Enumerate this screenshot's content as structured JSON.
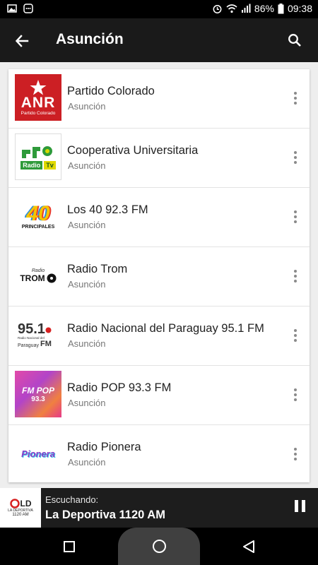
{
  "status_bar": {
    "battery": "86%",
    "time": "09:38"
  },
  "app_bar": {
    "title": "Asunción"
  },
  "stations": [
    {
      "name": "Partido Colorado",
      "city": "Asunción",
      "logo": "anr-logo"
    },
    {
      "name": "Cooperativa Universitaria",
      "city": "Asunción",
      "logo": "radio-tv-logo"
    },
    {
      "name": "Los 40 92.3 FM",
      "city": "Asunción",
      "logo": "los40-logo"
    },
    {
      "name": "Radio Trom",
      "city": "Asunción",
      "logo": "trom-logo"
    },
    {
      "name": "Radio Nacional del Paraguay 95.1 FM",
      "city": "Asunción",
      "logo": "radio-nacional-logo"
    },
    {
      "name": "Radio POP 93.3 FM",
      "city": "Asunción",
      "logo": "fm-pop-logo"
    },
    {
      "name": "Radio Pionera",
      "city": "Asunción",
      "logo": "pionera-logo"
    }
  ],
  "logo_text": {
    "anr": "ANR",
    "anr_sub": "Partido Colorado",
    "radio": "Radio",
    "tv": "Tv",
    "los40_num": "40",
    "los40_sub": "PRINCIPALES",
    "trom": "TROM",
    "trom_top": "Radio",
    "nacional_num": "95.1",
    "nacional_fm": "FM",
    "nacional_sub1": "Radio Nacional del",
    "nacional_sub2": "Paraguay",
    "pop_fm": "FM POP",
    "pop_num": "93.3",
    "pionera": "Pionera",
    "deportiva": "LD",
    "deportiva_sub": "LA DEPORTIVA",
    "deportiva_freq": "1120 AM"
  },
  "player": {
    "label": "Escuchando:",
    "station": "La Deportiva 1120 AM"
  },
  "colors": {
    "anr_red": "#cc1f24",
    "app_bar": "#1a1a1a",
    "player_bg": "#1d1d1d",
    "green": "#2e9a3a"
  }
}
